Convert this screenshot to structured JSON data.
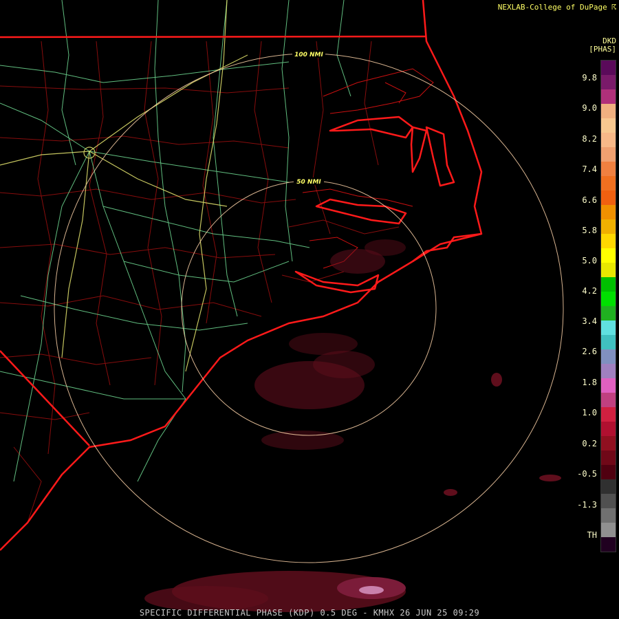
{
  "credit": "NEXLAB-College of DuPage",
  "credit_mark": "☈",
  "caption": "SPECIFIC DIFFERENTIAL PHASE (KDP) 0.5 DEG - KMHX 26 JUN 25 09:29",
  "legend": {
    "product": "DKD",
    "unit": "[PHAS]",
    "labels": [
      "9.8",
      "9.0",
      "8.2",
      "7.4",
      "6.6",
      "5.8",
      "5.0",
      "4.2",
      "3.4",
      "2.6",
      "1.8",
      "1.0",
      "0.2",
      "-0.5",
      "-1.3",
      "TH"
    ],
    "colors": [
      "#5a0a5a",
      "#7a1a6a",
      "#b0307a",
      "#f0b080",
      "#f8c890",
      "#f8b888",
      "#f0a070",
      "#f08040",
      "#f07020",
      "#f06010",
      "#f09000",
      "#f0b000",
      "#ffd800",
      "#ffff00",
      "#e8e800",
      "#00c000",
      "#00e000",
      "#20b020",
      "#60e0e0",
      "#40c0c0",
      "#8090c0",
      "#a080c0",
      "#e060c0",
      "#c04080",
      "#d02040",
      "#b01030",
      "#901020",
      "#700818",
      "#500010",
      "#303030",
      "#505050",
      "#707070",
      "#909090",
      "#200020"
    ]
  },
  "map": {
    "range_rings": [
      "100 NMI",
      "50 NMI"
    ],
    "colors": {
      "state": "#ff1a1a",
      "county": "#b01010",
      "highway": "#7aeea0",
      "interstate": "#e8e870",
      "ring": "#f0c8a0",
      "echo": "#7a1a2a"
    }
  }
}
